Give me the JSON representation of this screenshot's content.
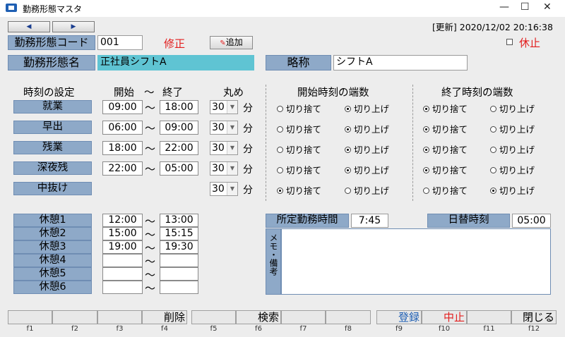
{
  "window": {
    "title": "勤務形態マスタ",
    "minimize": "—",
    "maximize": "☐",
    "close": "✕"
  },
  "nav": {
    "prev": "◀",
    "next": "▶"
  },
  "update": {
    "label": "[更新]",
    "datetime": "2020/12/02 20:16:38"
  },
  "form": {
    "code_label": "勤務形態コード",
    "code_value": "001",
    "mode": "修正",
    "add_button": "追加",
    "stop_label": "休止",
    "stop_checked": false,
    "name_label": "勤務形態名",
    "name_value": "正社員シフトA",
    "short_label": "略称",
    "short_value": "シフトA"
  },
  "time_settings": {
    "header": "時刻の設定",
    "start_header": "開始",
    "tilde": "〜",
    "end_header": "終了",
    "round_header": "丸め",
    "start_frac_header": "開始時刻の端数",
    "end_frac_header": "終了時刻の端数",
    "unit": "分",
    "round_down": "切り捨て",
    "round_up": "切り上げ",
    "rows": [
      {
        "label": "就業",
        "start": "09:00",
        "end": "18:00",
        "round": "30",
        "start_frac": "up",
        "end_frac": "down"
      },
      {
        "label": "早出",
        "start": "06:00",
        "end": "09:00",
        "round": "30",
        "start_frac": "up",
        "end_frac": "down"
      },
      {
        "label": "残業",
        "start": "18:00",
        "end": "22:00",
        "round": "30",
        "start_frac": "up",
        "end_frac": "down"
      },
      {
        "label": "深夜残",
        "start": "22:00",
        "end": "05:00",
        "round": "30",
        "start_frac": "up",
        "end_frac": "down"
      },
      {
        "label": "中抜け",
        "start": "",
        "end": "",
        "round": "30",
        "start_frac": "down",
        "end_frac": "up"
      }
    ]
  },
  "breaks": [
    {
      "label": "休憩1",
      "start": "12:00",
      "end": "13:00"
    },
    {
      "label": "休憩2",
      "start": "15:00",
      "end": "15:15"
    },
    {
      "label": "休憩3",
      "start": "19:00",
      "end": "19:30"
    },
    {
      "label": "休憩4",
      "start": "",
      "end": ""
    },
    {
      "label": "休憩5",
      "start": "",
      "end": ""
    },
    {
      "label": "休憩6",
      "start": "",
      "end": ""
    }
  ],
  "info": {
    "scheduled_label": "所定勤務時間",
    "scheduled_value": "7:45",
    "dayswitch_label": "日替時刻",
    "dayswitch_value": "05:00",
    "memo_label": "メモ・備考",
    "memo_value": ""
  },
  "function_keys": [
    {
      "key": "f1",
      "label": ""
    },
    {
      "key": "f2",
      "label": ""
    },
    {
      "key": "f3",
      "label": ""
    },
    {
      "key": "f4",
      "label": "削除"
    },
    {
      "key": "f5",
      "label": ""
    },
    {
      "key": "f6",
      "label": "検索"
    },
    {
      "key": "f7",
      "label": ""
    },
    {
      "key": "f8",
      "label": ""
    },
    {
      "key": "f9",
      "label": "登録"
    },
    {
      "key": "f10",
      "label": "中止"
    },
    {
      "key": "f11",
      "label": ""
    },
    {
      "key": "f12",
      "label": "閉じる"
    }
  ],
  "colors": {
    "label_bg": "#8ea9c8",
    "name_field_bg": "#5fc4d3",
    "red": "#e21d1d",
    "blue_text": "#1f5fb3"
  }
}
